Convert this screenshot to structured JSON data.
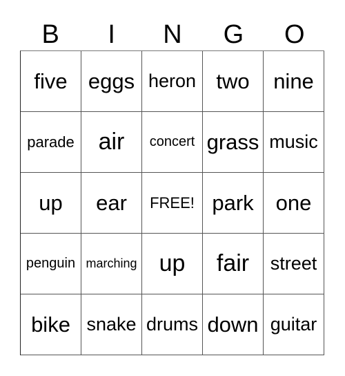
{
  "header": {
    "letters": [
      "B",
      "I",
      "N",
      "G",
      "O"
    ]
  },
  "card": {
    "cells": [
      [
        "five",
        "eggs",
        "heron",
        "two",
        "nine"
      ],
      [
        "parade",
        "air",
        "concert",
        "grass",
        "music"
      ],
      [
        "up",
        "ear",
        "FREE!",
        "park",
        "one"
      ],
      [
        "penguin",
        "marching",
        "up",
        "fair",
        "street"
      ],
      [
        "bike",
        "snake",
        "drums",
        "down",
        "guitar"
      ]
    ],
    "free_label": "FREE!"
  }
}
